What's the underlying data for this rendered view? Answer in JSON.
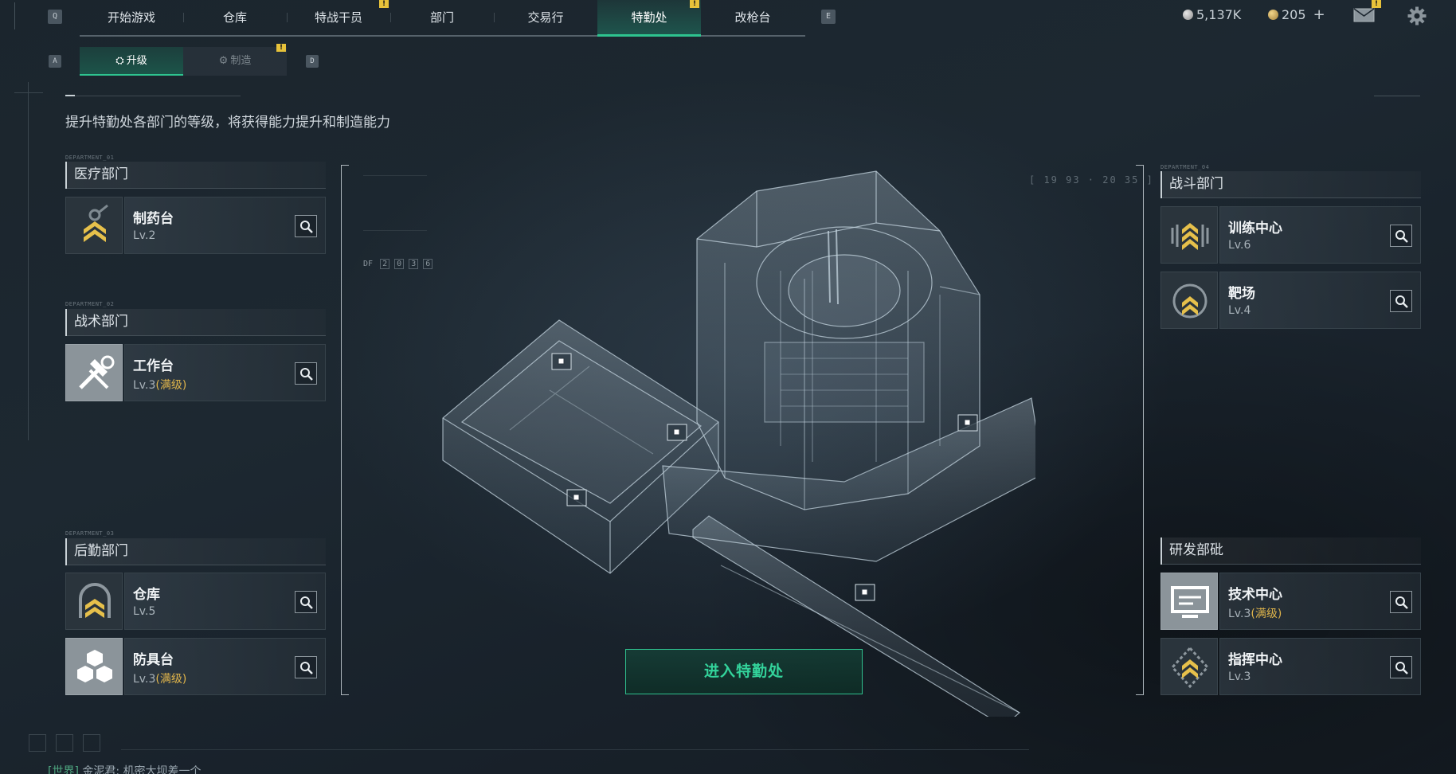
{
  "keys": {
    "prev_tab": "Q",
    "next_tab": "E",
    "prev_sub": "A",
    "next_sub": "D"
  },
  "nav": {
    "tabs": [
      "开始游戏",
      "仓库",
      "特战干员",
      "部门",
      "交易行",
      "特勤处",
      "改枪台"
    ],
    "active_tab": "特勤处"
  },
  "currency": {
    "coins": "5,137K",
    "tokens": "205",
    "add_symbol": "+"
  },
  "subtabs": {
    "upgrade": "升级",
    "craft": "制造"
  },
  "intro": "提升特勤处各部门的等级，将获得能力提升和制造能力",
  "departments": {
    "medical": {
      "tag": "DEPARTMENT_01",
      "title": "医疗部门",
      "items": [
        {
          "name": "制药台",
          "level": "Lv.2",
          "max": ""
        }
      ]
    },
    "tactical": {
      "tag": "DEPARTMENT_02",
      "title": "战术部门",
      "items": [
        {
          "name": "工作台",
          "level": "Lv.3",
          "max": "(满级)"
        }
      ]
    },
    "logistics": {
      "tag": "DEPARTMENT_03",
      "title": "后勤部门",
      "items": [
        {
          "name": "仓库",
          "level": "Lv.5",
          "max": ""
        },
        {
          "name": "防具台",
          "level": "Lv.3",
          "max": "(满级)"
        }
      ]
    },
    "combat": {
      "tag": "DEPARTMENT_04",
      "title": "战斗部门",
      "items": [
        {
          "name": "训练中心",
          "level": "Lv.6",
          "max": ""
        },
        {
          "name": "靶场",
          "level": "Lv.4",
          "max": ""
        }
      ]
    },
    "research": {
      "tag": "",
      "title": "研发部砒",
      "items": [
        {
          "name": "技术中心",
          "level": "Lv.3",
          "max": "(满级)"
        },
        {
          "name": "指挥中心",
          "level": "Lv.3",
          "max": ""
        }
      ]
    }
  },
  "hud": {
    "coords": "[ 19 93 · 20 35 ]",
    "df_label": "DF",
    "df_digits": [
      "2",
      "0",
      "3",
      "6"
    ]
  },
  "enter_button": "进入特勤处",
  "chat": {
    "channel": "[世界]",
    "sender": "金泥君:",
    "message": "机密大坝差一个"
  },
  "colors": {
    "accent": "#2ec38f",
    "max_level": "#e0b54b",
    "alert": "#e7c23a"
  },
  "icons": {
    "mail": "mail-icon",
    "settings": "gear-icon",
    "search": "search-icon"
  }
}
